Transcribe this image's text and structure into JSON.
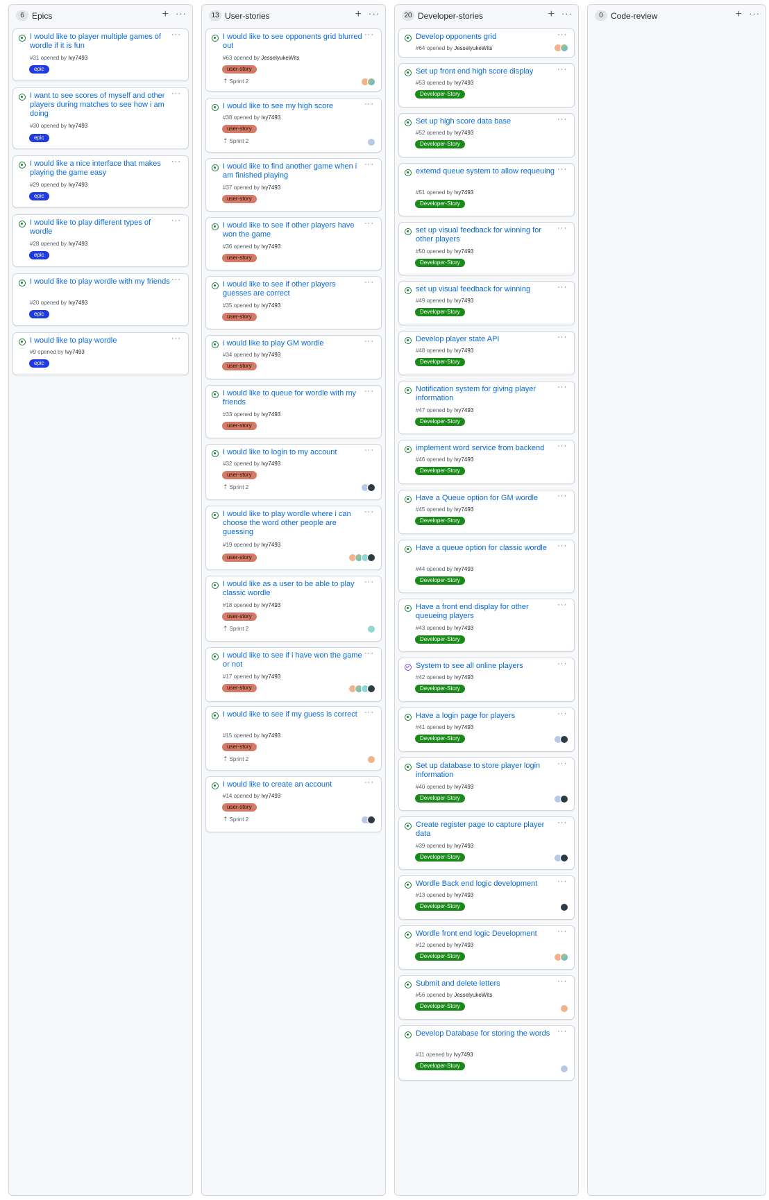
{
  "columns": [
    {
      "count": "6",
      "title": "Epics"
    },
    {
      "count": "13",
      "title": "User-stories"
    },
    {
      "count": "20",
      "title": "Developer-stories"
    },
    {
      "count": "0",
      "title": "Code-review"
    }
  ],
  "common": {
    "add_icon": "+",
    "more_icon": "···",
    "opened_by": "opened by",
    "sprint": "Sprint 2"
  },
  "labels": {
    "epic": "epic",
    "user_story": "user-story",
    "dev": "Developer-Story"
  },
  "colors": {
    "link": "#0969da",
    "open": "#1a7f37",
    "closed": "#8250df",
    "epic": "#1f3adf",
    "user_story": "#d47a68",
    "dev": "#1a8a1a"
  },
  "epics": [
    {
      "title": "I would like to player multiple games of wordle if it is fun",
      "num": "#31",
      "author": "Ivy7493"
    },
    {
      "title": "I want to see scores of myself and other players during matches to see how i am doing",
      "num": "#30",
      "author": "Ivy7493"
    },
    {
      "title": "I would like a nice interface that makes playing the game easy",
      "num": "#29",
      "author": "Ivy7493"
    },
    {
      "title": "I would like to play different types of wordle",
      "num": "#28",
      "author": "Ivy7493"
    },
    {
      "title": "I would like to play wordle with my friends",
      "num": "#20",
      "author": "Ivy7493"
    },
    {
      "title": "I would like to play wordle",
      "num": "#9",
      "author": "Ivy7493"
    }
  ],
  "user_stories": [
    {
      "title": "I would like to see opponents grid blurred out",
      "num": "#63",
      "author": "JesselyukeWits"
    },
    {
      "title": "I would like to see my high score",
      "num": "#38",
      "author": "Ivy7493"
    },
    {
      "title": "I would like to find another game when i am finished playing",
      "num": "#37",
      "author": "Ivy7493"
    },
    {
      "title": "I would like to see if other players have won the game",
      "num": "#36",
      "author": "Ivy7493"
    },
    {
      "title": "I would like to see if other players guesses are correct",
      "num": "#35",
      "author": "Ivy7493"
    },
    {
      "title": "i would like to play GM wordle",
      "num": "#34",
      "author": "Ivy7493"
    },
    {
      "title": "I would like to queue for wordle with my friends",
      "num": "#33",
      "author": "Ivy7493"
    },
    {
      "title": "I would like to login to my account",
      "num": "#32",
      "author": "Ivy7493"
    },
    {
      "title": "I would like to play wordle where i can choose the word other people are guessing",
      "num": "#19",
      "author": "Ivy7493"
    },
    {
      "title": "I would like as a user to be able to play classic wordle",
      "num": "#18",
      "author": "Ivy7493"
    },
    {
      "title": "I would like to see if i have won the game or not",
      "num": "#17",
      "author": "Ivy7493"
    },
    {
      "title": "I would like to see if my guess is correct",
      "num": "#15",
      "author": "Ivy7493"
    },
    {
      "title": "I would like to create an account",
      "num": "#14",
      "author": "Ivy7493"
    }
  ],
  "dev_stories": [
    {
      "title": "Develop opponents grid",
      "num": "#64",
      "author": "JesselyukeWits"
    },
    {
      "title": "Set up front end high score display",
      "num": "#53",
      "author": "Ivy7493"
    },
    {
      "title": "Set up high score data base",
      "num": "#52",
      "author": "Ivy7493"
    },
    {
      "title": "extemd queue system to allow requeuing",
      "num": "#51",
      "author": "Ivy7493"
    },
    {
      "title": "set up visual feedback for winning for other players",
      "num": "#50",
      "author": "Ivy7493"
    },
    {
      "title": "set up visual feedback for winning",
      "num": "#49",
      "author": "Ivy7493"
    },
    {
      "title": "Develop player state API",
      "num": "#48",
      "author": "Ivy7493"
    },
    {
      "title": "Notification system for giving player information",
      "num": "#47",
      "author": "Ivy7493"
    },
    {
      "title": "implement word service from backend",
      "num": "#46",
      "author": "Ivy7493"
    },
    {
      "title": "Have a Queue option for GM wordle",
      "num": "#45",
      "author": "Ivy7493"
    },
    {
      "title": "Have a queue option for classic wordle",
      "num": "#44",
      "author": "Ivy7493"
    },
    {
      "title": "Have a front end display for other queueing players",
      "num": "#43",
      "author": "Ivy7493"
    },
    {
      "title": "System to see all online players",
      "num": "#42",
      "author": "Ivy7493"
    },
    {
      "title": "Have a login page for players",
      "num": "#41",
      "author": "Ivy7493"
    },
    {
      "title": "Set up database to store player login information",
      "num": "#40",
      "author": "Ivy7493"
    },
    {
      "title": "Create register page to capture player data",
      "num": "#39",
      "author": "Ivy7493"
    },
    {
      "title": "Wordle Back end logic development",
      "num": "#13",
      "author": "Ivy7493"
    },
    {
      "title": "Wordle front end logic Development",
      "num": "#12",
      "author": "Ivy7493"
    },
    {
      "title": "Submit and delete letters",
      "num": "#56",
      "author": "JesselyukeWits"
    },
    {
      "title": "Develop Database for storing the words",
      "num": "#11",
      "author": "Ivy7493"
    }
  ]
}
